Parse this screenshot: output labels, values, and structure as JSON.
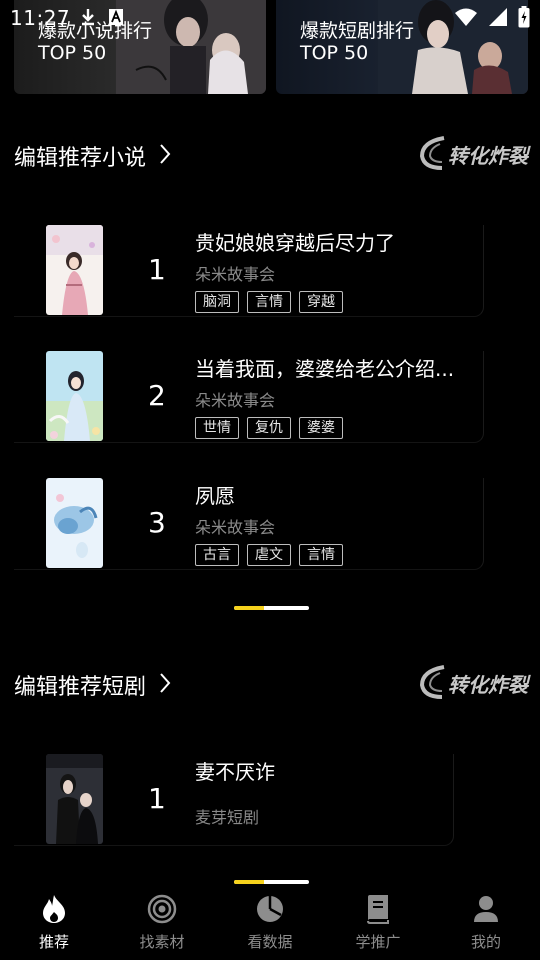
{
  "status_bar": {
    "time": "11:27"
  },
  "banners": [
    {
      "title": "爆款小说排行",
      "subtitle": "TOP 50"
    },
    {
      "title": "爆款短剧排行",
      "subtitle": "TOP 50"
    }
  ],
  "novels_section": {
    "title": "编辑推荐小说",
    "brand": "转化炸裂",
    "items": [
      {
        "rank": "1",
        "title": "贵妃娘娘穿越后尽力了",
        "author": "朵米故事会",
        "tags": [
          "脑洞",
          "言情",
          "穿越"
        ]
      },
      {
        "rank": "2",
        "title": "当着我面，婆婆给老公介绍...",
        "author": "朵米故事会",
        "tags": [
          "世情",
          "复仇",
          "婆婆"
        ]
      },
      {
        "rank": "3",
        "title": "夙愿",
        "author": "朵米故事会",
        "tags": [
          "古言",
          "虐文",
          "言情"
        ]
      }
    ],
    "carousel_progress": 0.4
  },
  "dramas_section": {
    "title": "编辑推荐短剧",
    "brand": "转化炸裂",
    "items": [
      {
        "rank": "1",
        "title": "妻不厌诈",
        "author": "麦芽短剧"
      }
    ],
    "carousel_progress": 0.4
  },
  "bottom_nav": {
    "items": [
      {
        "label": "推荐",
        "icon": "flame-icon",
        "active": true
      },
      {
        "label": "找素材",
        "icon": "target-icon",
        "active": false
      },
      {
        "label": "看数据",
        "icon": "pie-chart-icon",
        "active": false
      },
      {
        "label": "学推广",
        "icon": "book-icon",
        "active": false
      },
      {
        "label": "我的",
        "icon": "user-icon",
        "active": false
      }
    ]
  },
  "colors": {
    "accent": "#f6d21d",
    "background": "#000000",
    "muted_text": "#8a8a8a"
  }
}
